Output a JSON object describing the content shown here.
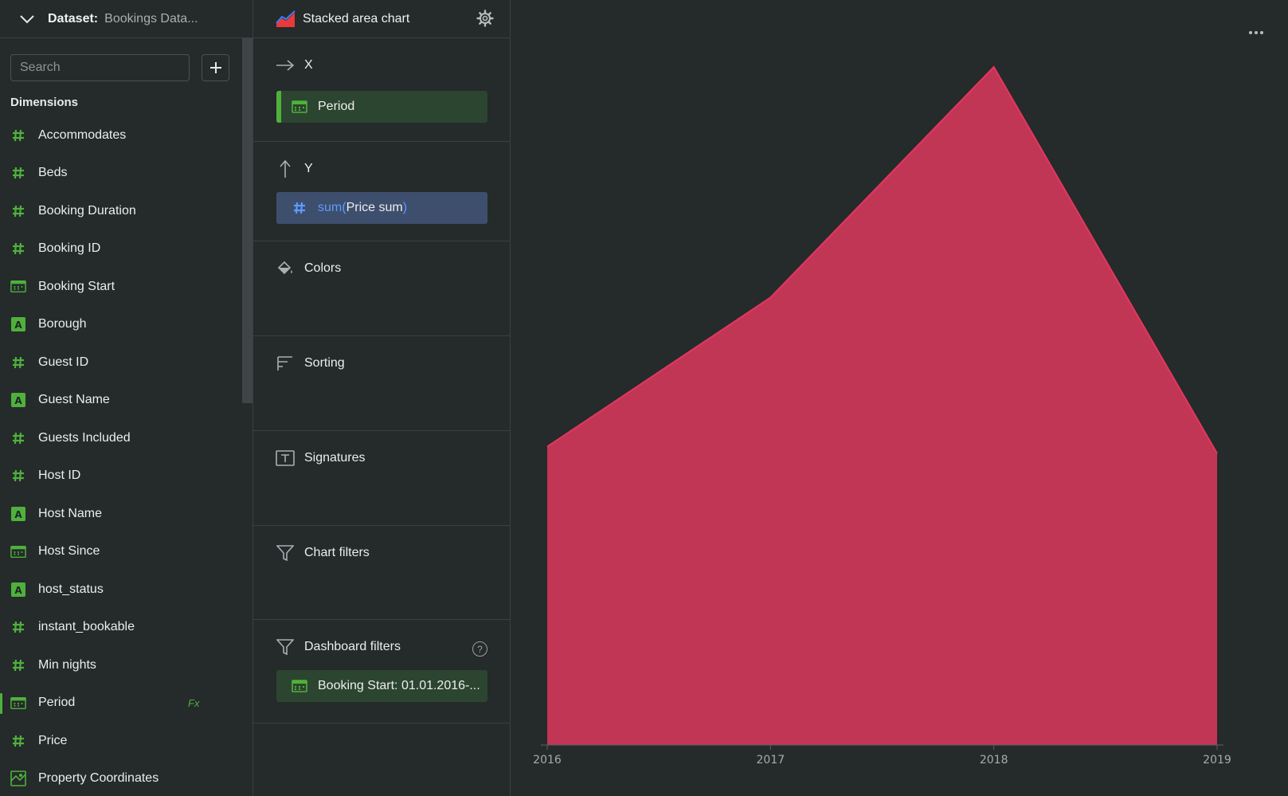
{
  "sidebar": {
    "dataset_label": "Dataset:",
    "dataset_name": "Bookings Data...",
    "search_placeholder": "Search",
    "section_title": "Dimensions",
    "items": [
      {
        "label": "Accommodates",
        "type": "number"
      },
      {
        "label": "Beds",
        "type": "number"
      },
      {
        "label": "Booking Duration",
        "type": "number"
      },
      {
        "label": "Booking ID",
        "type": "number"
      },
      {
        "label": "Booking Start",
        "type": "date"
      },
      {
        "label": "Borough",
        "type": "string"
      },
      {
        "label": "Guest ID",
        "type": "number"
      },
      {
        "label": "Guest Name",
        "type": "string"
      },
      {
        "label": "Guests Included",
        "type": "number"
      },
      {
        "label": "Host ID",
        "type": "number"
      },
      {
        "label": "Host Name",
        "type": "string"
      },
      {
        "label": "Host Since",
        "type": "date"
      },
      {
        "label": "host_status",
        "type": "string"
      },
      {
        "label": "instant_bookable",
        "type": "number"
      },
      {
        "label": "Min nights",
        "type": "number"
      },
      {
        "label": "Period",
        "type": "date",
        "formula_badge": "Fx",
        "active": true
      },
      {
        "label": "Price",
        "type": "number"
      },
      {
        "label": "Property Coordinates",
        "type": "geo"
      }
    ]
  },
  "config": {
    "chart_type_label": "Stacked area chart",
    "sections": {
      "x": {
        "title": "X",
        "field": "Period"
      },
      "y": {
        "title": "Y",
        "fn": "sum(",
        "field": "Price sum",
        "fn_close": ")"
      },
      "colors": {
        "title": "Colors"
      },
      "sorting": {
        "title": "Sorting"
      },
      "signatures": {
        "title": "Signatures"
      },
      "chart_filters": {
        "title": "Chart filters"
      },
      "dashboard_filters": {
        "title": "Dashboard filters",
        "help": "?",
        "field": "Booking Start: 01.01.2016-..."
      }
    }
  },
  "chart_data": {
    "type": "area",
    "stacked": true,
    "x": [
      "2016",
      "2017",
      "2018",
      "2019"
    ],
    "series": [
      {
        "values": [
          0.44,
          0.66,
          1.0,
          0.43
        ]
      }
    ],
    "ylim": [
      0,
      1
    ],
    "grid": false,
    "colors": {
      "fill": "#c13655",
      "stroke": "#e4365f",
      "axis": "#5a6061"
    }
  },
  "more_icon": "more-horizontal-icon"
}
